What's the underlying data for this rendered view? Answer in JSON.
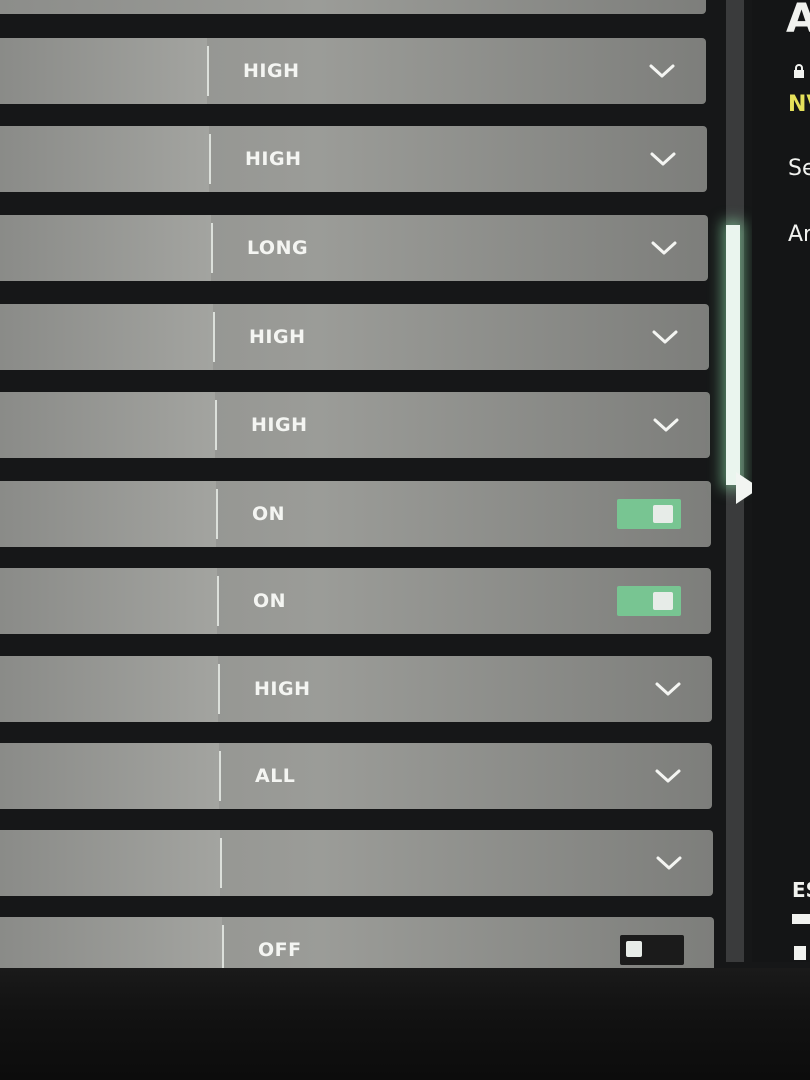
{
  "settings_rows": [
    {
      "value": "HIGH",
      "control": "dropdown"
    },
    {
      "value": "HIGH",
      "control": "dropdown"
    },
    {
      "value": "LONG",
      "control": "dropdown"
    },
    {
      "value": "HIGH",
      "control": "dropdown"
    },
    {
      "value": "HIGH",
      "control": "dropdown"
    },
    {
      "value": "ON",
      "control": "toggle",
      "state": "on"
    },
    {
      "value": "ON",
      "control": "toggle",
      "state": "on"
    },
    {
      "value": "HIGH",
      "control": "dropdown"
    },
    {
      "value": "ALL",
      "control": "dropdown"
    },
    {
      "value": "",
      "control": "dropdown"
    },
    {
      "value": "OFF",
      "control": "toggle",
      "state": "off"
    }
  ],
  "right_panel": {
    "title": "A",
    "lock_icon": "lock-icon",
    "highlight_text": "NV",
    "line1": "Se",
    "line2": "Ar",
    "footer_text": "ES"
  },
  "colors": {
    "toggle_on": "#78c592",
    "scroll_thumb": "#eaf5ee",
    "accent_yellow": "#e4e05a"
  }
}
